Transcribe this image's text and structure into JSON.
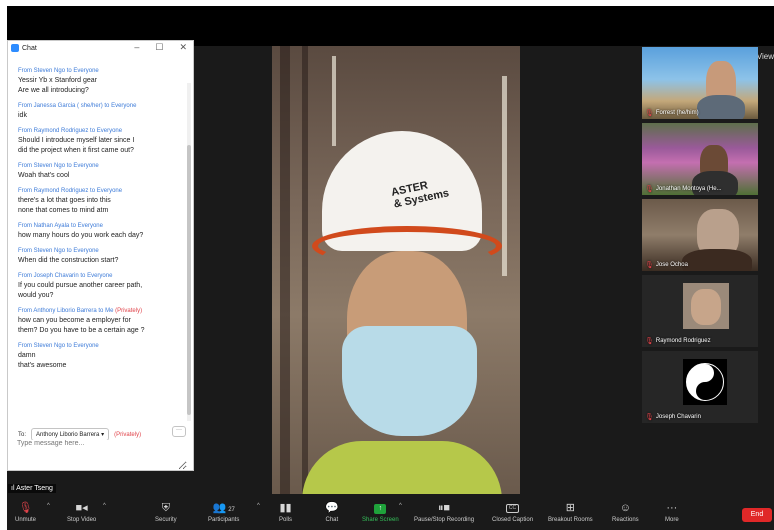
{
  "chat": {
    "title": "Chat",
    "messages": [
      {
        "from": "Steven Ngo",
        "to": "Everyone",
        "private": false,
        "lines": [
          "Yessir Yb x Stanford gear",
          "Are we all introducing?"
        ]
      },
      {
        "from": "Janessa Garcia ( she/her)",
        "to": "Everyone",
        "private": false,
        "lines": [
          "idk"
        ]
      },
      {
        "from": "Raymond Rodriguez",
        "to": "Everyone",
        "private": false,
        "lines": [
          "Should I introduce myself later since I",
          "did the project when it first came out?"
        ]
      },
      {
        "from": "Steven Ngo",
        "to": "Everyone",
        "private": false,
        "lines": [
          "Woah that's cool"
        ]
      },
      {
        "from": "Raymond Rodriguez",
        "to": "Everyone",
        "private": false,
        "lines": [
          "there's a lot that goes into this",
          "none that comes to mind atm"
        ]
      },
      {
        "from": "Nathan Ayala",
        "to": "Everyone",
        "private": false,
        "lines": [
          "how many hours do you work each day?"
        ]
      },
      {
        "from": "Steven Ngo",
        "to": "Everyone",
        "private": false,
        "lines": [
          "When did the construction start?"
        ]
      },
      {
        "from": "Joseph Chavarin",
        "to": "Everyone",
        "private": false,
        "lines": [
          "If you could pursue another career path,",
          "would you?"
        ]
      },
      {
        "from": "Anthony Liborio Barrera",
        "to": "Me",
        "private": true,
        "lines": [
          "how can you become a employer for",
          "them? Do you have to be a certain age ?"
        ]
      },
      {
        "from": "Steven Ngo",
        "to": "Everyone",
        "private": false,
        "lines": [
          "damn",
          "that's awesome"
        ]
      }
    ],
    "from_word": "From",
    "to_word": "to",
    "private_tag": "(Privately)",
    "to_label": "To:",
    "recipient": "Anthony Liborio Barrera",
    "privately": "(Privately)",
    "more": "···",
    "input_placeholder": "Type message here..."
  },
  "view_button": "View",
  "main_video": {
    "speaker_label": "Aster Tseng",
    "hat_text": "ASTER",
    "hat_subtext": "& Systems"
  },
  "participants": [
    {
      "name": "Forrest (he/him)"
    },
    {
      "name": "Jonathan Montoya (He..."
    },
    {
      "name": "Jose Ochoa"
    },
    {
      "name": "Raymond Rodriguez"
    },
    {
      "name": "Joseph Chavarin"
    }
  ],
  "toolbar": {
    "unmute": "Unmute",
    "stop_video": "Stop Video",
    "security": "Security",
    "participants": "Participants",
    "participant_count": "27",
    "polls": "Polls",
    "chat": "Chat",
    "share_screen": "Share Screen",
    "pause_recording": "Pause/Stop Recording",
    "closed_caption": "Closed Caption",
    "breakout_rooms": "Breakout Rooms",
    "reactions": "Reactions",
    "more": "More",
    "end": "End"
  },
  "colors": {
    "link_blue": "#3d7bd8",
    "private_red": "#e0434a",
    "share_green": "#1fa33b",
    "end_red": "#e02828"
  }
}
